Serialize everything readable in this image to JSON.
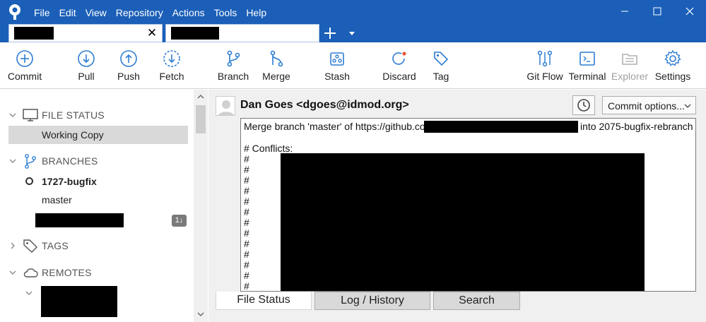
{
  "menu": [
    "File",
    "Edit",
    "View",
    "Repository",
    "Actions",
    "Tools",
    "Help"
  ],
  "tabs": {
    "close_glyph": "✕"
  },
  "toolbar": {
    "commit": "Commit",
    "pull": "Pull",
    "push": "Push",
    "fetch": "Fetch",
    "branch": "Branch",
    "merge": "Merge",
    "stash": "Stash",
    "discard": "Discard",
    "tag": "Tag",
    "gitflow": "Git Flow",
    "terminal": "Terminal",
    "explorer": "Explorer",
    "settings": "Settings"
  },
  "sidebar": {
    "file_status": "FILE STATUS",
    "working_copy": "Working Copy",
    "branches": "BRANCHES",
    "current_branch": "1727-bugfix",
    "master": "master",
    "branch_badge": "1↓",
    "tags": "TAGS",
    "remotes": "REMOTES"
  },
  "commit": {
    "author": "Dan Goes <dgoes@idmod.org>",
    "options_label": "Commit options...",
    "message_start": "Merge branch 'master' of https://github.com/",
    "message_end": "into 2075-bugfix-rebranch",
    "conflicts": "# Conflicts:",
    "hash": "#"
  },
  "bottom_tabs": {
    "file_status": "File Status",
    "log_history": "Log / History",
    "search": "Search"
  },
  "colors": {
    "titlebar": "#1b5fb8",
    "accent": "#2d7dd2",
    "discard_dot": "#e8553a"
  }
}
